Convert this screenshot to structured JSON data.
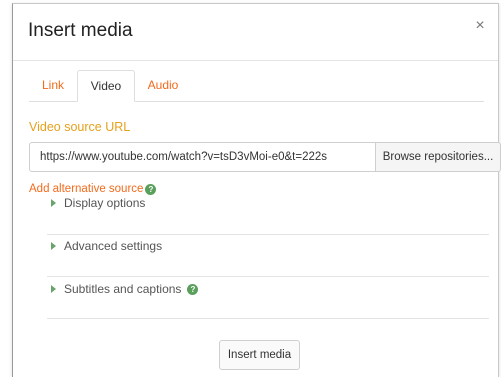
{
  "dialog": {
    "title": "Insert media",
    "close_glyph": "×"
  },
  "tabs": [
    {
      "label": "Link",
      "active": false
    },
    {
      "label": "Video",
      "active": true
    },
    {
      "label": "Audio",
      "active": false
    }
  ],
  "video": {
    "source_label": "Video source URL",
    "url_value": "https://www.youtube.com/watch?v=tsD3vMoi-e0&t=222s",
    "browse_label": "Browse repositories...",
    "add_alt_source": "Add alternative source",
    "help_glyph": "?"
  },
  "sections": [
    {
      "label": "Display options",
      "has_help": false
    },
    {
      "label": "Advanced settings",
      "has_help": false
    },
    {
      "label": "Subtitles and captions",
      "has_help": true
    }
  ],
  "footer": {
    "insert_label": "Insert media"
  },
  "colors": {
    "tab_link": "#f26b1d",
    "section_label": "#e5a11c",
    "help_icon": "#5aa05c",
    "caret": "#6aa36b"
  },
  "icons": {
    "close": "close-icon",
    "help": "help-icon",
    "expand": "caret-right-icon"
  }
}
